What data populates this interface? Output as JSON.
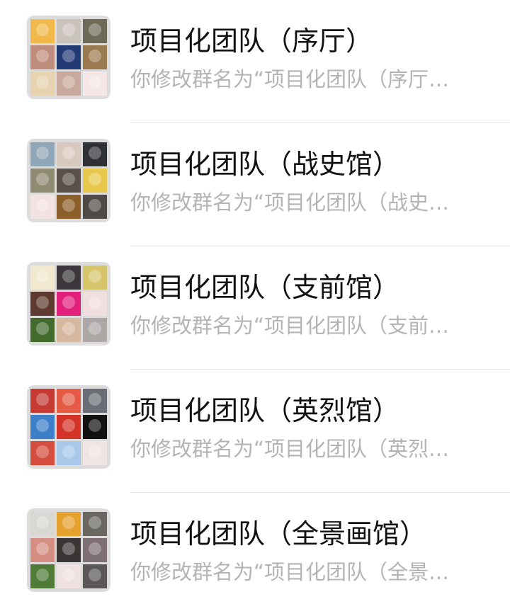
{
  "chats": [
    {
      "title": "项目化团队（序厅）",
      "preview": "你修改群名为“项目化团队（序厅…",
      "avatar_colors": [
        "#f0b94a",
        "#c9c3bb",
        "#6f6a58",
        "#c08d7c",
        "#233a74",
        "#9c7a50",
        "#e7d3b0",
        "#c8a99c",
        "#f4e7e6"
      ]
    },
    {
      "title": "项目化团队（战史馆）",
      "preview": "你修改群名为“项目化团队（战史…",
      "avatar_colors": [
        "#8fa7b8",
        "#d8c8bd",
        "#2f3135",
        "#8f8a72",
        "#5b4f49",
        "#e8c84c",
        "#f3e2e2",
        "#8c5f2a",
        "#4f4a45"
      ]
    },
    {
      "title": "项目化团队（支前馆）",
      "preview": "你修改群名为“项目化团队（支前…",
      "avatar_colors": [
        "#f2e8cf",
        "#3a3639",
        "#d7c56b",
        "#5e3b2e",
        "#e31f7d",
        "#f1dede",
        "#436b2e",
        "#d7b89f",
        "#ada7a5"
      ]
    },
    {
      "title": "项目化团队（英烈馆）",
      "preview": "你修改群名为“项目化团队（英烈…",
      "avatar_colors": [
        "#c53b34",
        "#e55a45",
        "#6a6f77",
        "#3d7fc8",
        "#d33327",
        "#111111",
        "#d54d3f",
        "#a7c8e8",
        "#f1e4e4"
      ]
    },
    {
      "title": "项目化团队（全景画馆）",
      "preview": "你修改群名为“项目化团队（全景…",
      "avatar_colors": [
        "#d8d7d2",
        "#e6a12f",
        "#6a6760",
        "#d58f82",
        "#3b3536",
        "#7e6f75",
        "#4f7b37",
        "#efe1df",
        "#5b5657"
      ]
    }
  ]
}
